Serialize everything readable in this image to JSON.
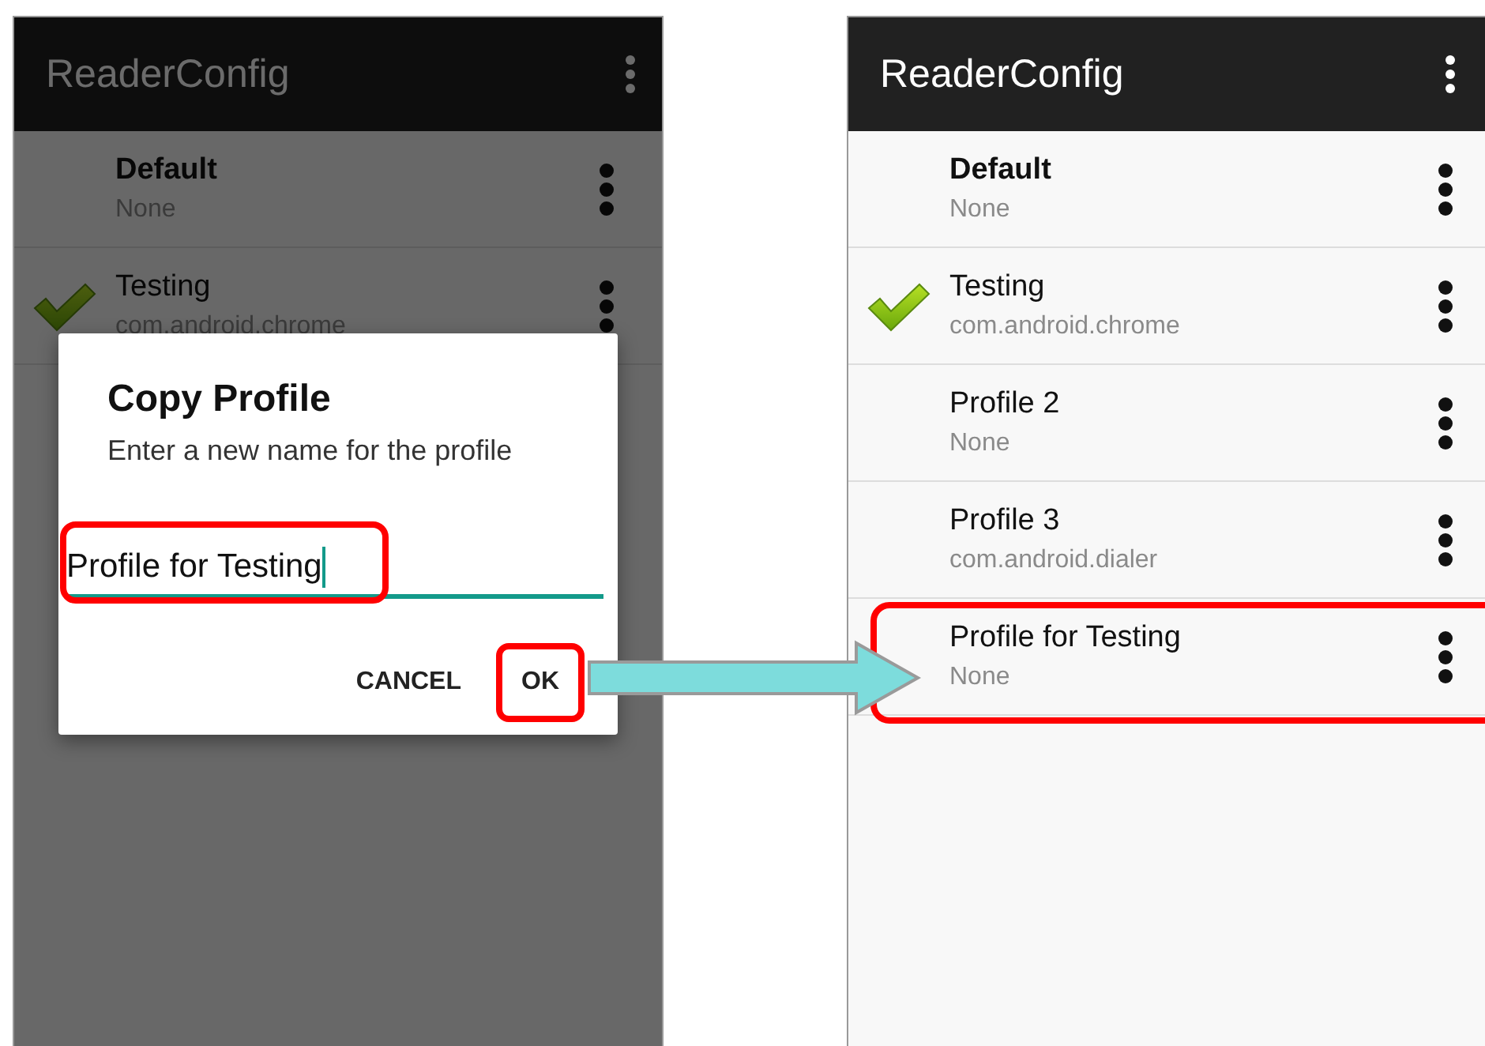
{
  "screens": [
    {
      "app_bar": {
        "title": "ReaderConfig"
      },
      "dimmed": true,
      "profiles": [
        {
          "name": "Default",
          "detail": "None",
          "bold": true,
          "active": false,
          "highlighted": false
        },
        {
          "name": "Testing",
          "detail": "com.android.chrome",
          "bold": false,
          "active": true,
          "highlighted": false
        }
      ],
      "dialog": {
        "title": "Copy Profile",
        "message": "Enter a new name for the profile",
        "field": {
          "value": "Profile for Testing",
          "highlighted": true
        },
        "buttons": [
          {
            "label": "CANCEL",
            "highlighted": false
          },
          {
            "label": "OK",
            "highlighted": true
          }
        ]
      }
    },
    {
      "app_bar": {
        "title": "ReaderConfig"
      },
      "dimmed": false,
      "profiles": [
        {
          "name": "Default",
          "detail": "None",
          "bold": true,
          "active": false,
          "highlighted": false
        },
        {
          "name": "Testing",
          "detail": "com.android.chrome",
          "bold": false,
          "active": true,
          "highlighted": false
        },
        {
          "name": "Profile 2",
          "detail": "None",
          "bold": false,
          "active": false,
          "highlighted": false
        },
        {
          "name": "Profile 3",
          "detail": "com.android.dialer",
          "bold": false,
          "active": false,
          "highlighted": false
        },
        {
          "name": "Profile for Testing",
          "detail": "None",
          "bold": false,
          "active": false,
          "highlighted": true
        }
      ]
    }
  ],
  "connector": {
    "shown": true
  }
}
